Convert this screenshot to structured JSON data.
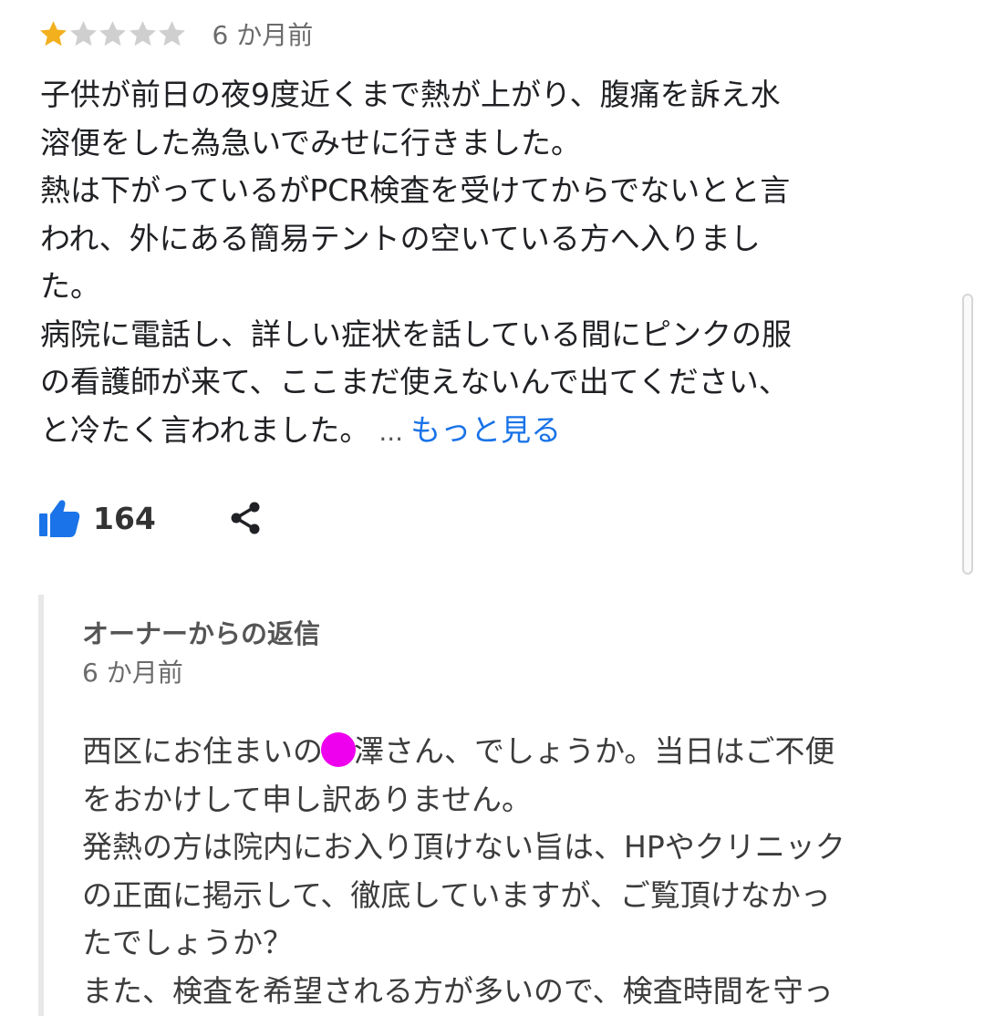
{
  "review": {
    "rating": 1,
    "rating_max": 5,
    "star_filled_color": "#f2b01e",
    "star_empty_color": "#cfcfcf",
    "time": "6 か月前",
    "lines": [
      "子供が前日の夜9度近くまで熱が上がり、腹痛を訴え水",
      "溶便をした為急いでみせに行きました。",
      "熱は下がっているがPCR検査を受けてからでないとと言",
      "われ、外にある簡易テントの空いている方へ入りまし",
      "た。",
      "病院に電話し、詳しい症状を話している間にピンクの服",
      "の看護師が来て、ここまだ使えないんで出てください、",
      "と冷たく言われました。"
    ],
    "ellipsis": "...",
    "more_label": "もっと見る",
    "more_color": "#1a73e8"
  },
  "actions": {
    "like_icon": "thumbs-up-icon",
    "like_count": "164",
    "share_icon": "share-icon",
    "like_color": "#1a73e8"
  },
  "owner_reply": {
    "title": "オーナーからの返信",
    "time": "6 か月前",
    "line1_before": "西区にお住まいの",
    "line1_after": "澤さん、でしょうか。当日はご不便",
    "lines": [
      "をおかけして申し訳ありません。",
      "発熱の方は院内にお入り頂けない旨は、HPやクリニック",
      "の正面に掲示して、徹底していますが、ご覧頂けなかっ",
      "たでしょうか？",
      "また、検査を希望される方が多いので、検査時間を守っ"
    ],
    "redaction_color": "#ee00ee"
  }
}
